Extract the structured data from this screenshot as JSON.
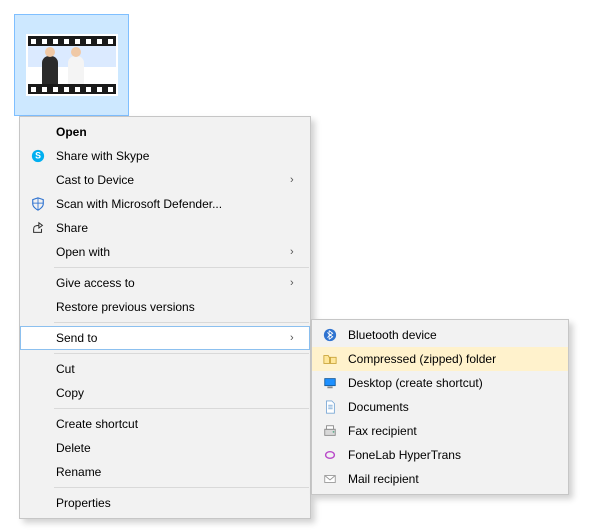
{
  "file": {
    "type": "video"
  },
  "contextMenu": {
    "items": [
      {
        "label": "Open"
      },
      {
        "label": "Share with Skype"
      },
      {
        "label": "Cast to Device"
      },
      {
        "label": "Scan with Microsoft Defender..."
      },
      {
        "label": "Share"
      },
      {
        "label": "Open with"
      },
      {
        "label": "Give access to"
      },
      {
        "label": "Restore previous versions"
      },
      {
        "label": "Send to"
      },
      {
        "label": "Cut"
      },
      {
        "label": "Copy"
      },
      {
        "label": "Create shortcut"
      },
      {
        "label": "Delete"
      },
      {
        "label": "Rename"
      },
      {
        "label": "Properties"
      }
    ]
  },
  "sendToSubmenu": {
    "items": [
      {
        "label": "Bluetooth device"
      },
      {
        "label": "Compressed (zipped) folder"
      },
      {
        "label": "Desktop (create shortcut)"
      },
      {
        "label": "Documents"
      },
      {
        "label": "Fax recipient"
      },
      {
        "label": "FoneLab HyperTrans"
      },
      {
        "label": "Mail recipient"
      }
    ]
  }
}
